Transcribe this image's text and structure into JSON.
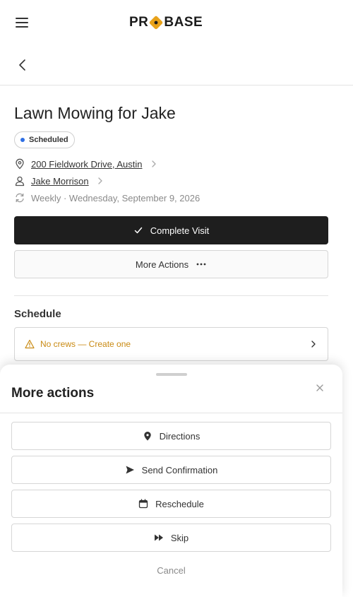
{
  "header": {
    "logo_text_left": "PR",
    "logo_text_right": "BASE"
  },
  "job": {
    "title": "Lawn Mowing for Jake",
    "status": "Scheduled",
    "address": "200 Fieldwork Drive, Austin",
    "client": "Jake Morrison",
    "recurrence": "Weekly · Wednesday, September 9, 2026"
  },
  "actions": {
    "complete_visit": "Complete Visit",
    "more_actions": "More Actions"
  },
  "schedule": {
    "title": "Schedule",
    "crew_warning": "No crews — Create one"
  },
  "sheet": {
    "title": "More actions",
    "buttons": [
      {
        "label": "Directions",
        "icon": "map-pin-icon"
      },
      {
        "label": "Send Confirmation",
        "icon": "send-icon"
      },
      {
        "label": "Reschedule",
        "icon": "calendar-icon"
      },
      {
        "label": "Skip",
        "icon": "fast-forward-icon"
      }
    ],
    "cancel": "Cancel"
  },
  "colors": {
    "accent": "#e8a21a",
    "status_dot": "#2f6fe4",
    "warning": "#c98a13",
    "primary_button": "#1e1e1e"
  }
}
